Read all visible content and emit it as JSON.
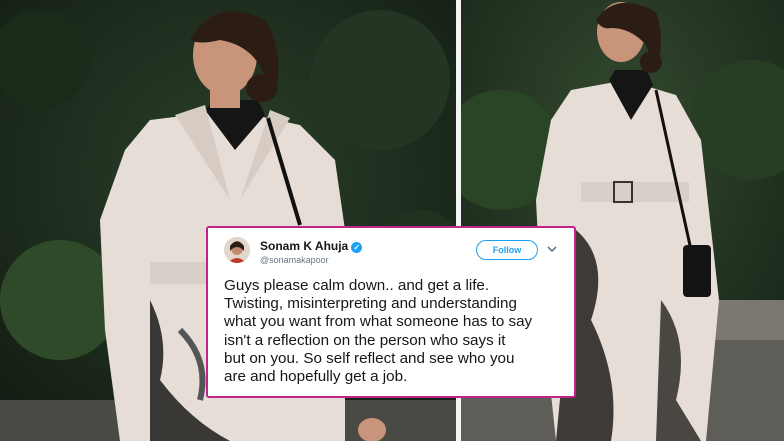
{
  "tweet": {
    "name": "Sonam K Ahuja",
    "handle": "@sonamakapoor",
    "follow_label": "Follow",
    "text": "Guys please calm down.. and get a life.\nTwisting, misinterpreting and understanding\nwhat you want from what someone has to say\nisn't a reflection on the person who says it\nbut on you. So self reflect and see who you\nare and hopefully get a job.",
    "verified_icon": "verified-badge-icon",
    "menu_icon": "chevron-down-icon"
  },
  "colors": {
    "card_border": "#c0238b",
    "twitter_blue": "#1da1f2",
    "coat": "#e6ddd6",
    "foliage": "#1f3320"
  }
}
